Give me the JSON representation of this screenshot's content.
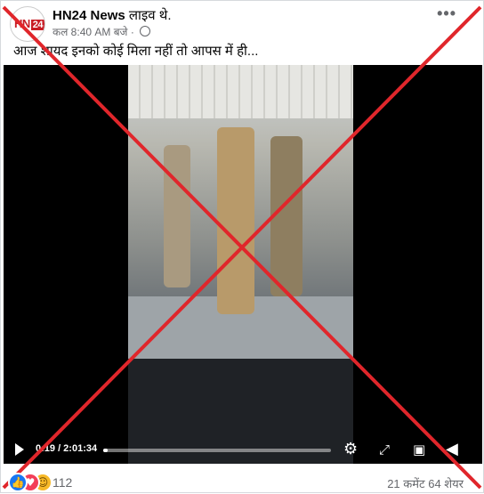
{
  "post": {
    "page_name": "HN24 News",
    "live_status": "लाइव थे.",
    "time": "कल 8:40 AM बजे",
    "separator": "·",
    "more": "•••",
    "text": "आज शायद इनको कोई मिला नहीं तो आपस में ही..."
  },
  "avatar": {
    "logo_text": "HN",
    "logo_badge": "24"
  },
  "video": {
    "current_time": "0:19",
    "duration": "2:01:34",
    "time_display": "0:19 / 2:01:34",
    "progress": 0.0026,
    "controls": [
      "play-icon",
      "settings-icon",
      "fullscreen-icon",
      "pip-icon",
      "volume-icon"
    ]
  },
  "footer": {
    "reaction_count": "112",
    "reactions": [
      "like-icon",
      "love-icon",
      "haha-icon"
    ],
    "comments": "21 कमेंट",
    "shares": "64 शेयर"
  },
  "colors": {
    "cross": "#e0262b",
    "like": "#1877f2",
    "love": "#f33e58",
    "haha": "#f7b928"
  }
}
